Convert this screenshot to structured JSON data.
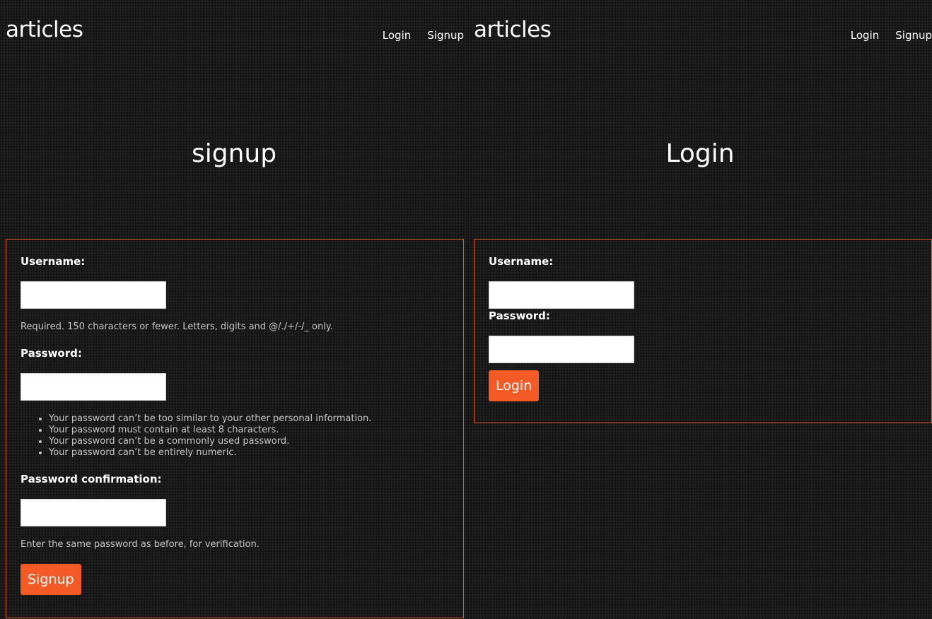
{
  "signup_page": {
    "logo": "articles",
    "nav": {
      "login": "Login",
      "signup": "Signup"
    },
    "title": "signup",
    "form": {
      "username_label": "Username:",
      "username_value": "",
      "username_help": "Required. 150 characters or fewer. Letters, digits and @/./+/-/_ only.",
      "password_label": "Password:",
      "password_value": "",
      "password_rules": [
        "Your password can’t be too similar to your other personal information.",
        "Your password must contain at least 8 characters.",
        "Your password can’t be a commonly used password.",
        "Your password can’t be entirely numeric."
      ],
      "password2_label": "Password confirmation:",
      "password2_value": "",
      "password2_help": "Enter the same password as before, for verification.",
      "submit_label": "Signup"
    }
  },
  "login_page": {
    "logo": "articles",
    "nav": {
      "login": "Login",
      "signup": "Signup"
    },
    "title": "Login",
    "form": {
      "username_label": "Username:",
      "username_value": "",
      "password_label": "Password:",
      "password_value": "",
      "submit_label": "Login"
    }
  },
  "colors": {
    "background": "#1a1a1a",
    "accent": "#f35a26",
    "border": "#e4572e",
    "text": "#ffffff",
    "help_text": "#c6c6c6"
  }
}
